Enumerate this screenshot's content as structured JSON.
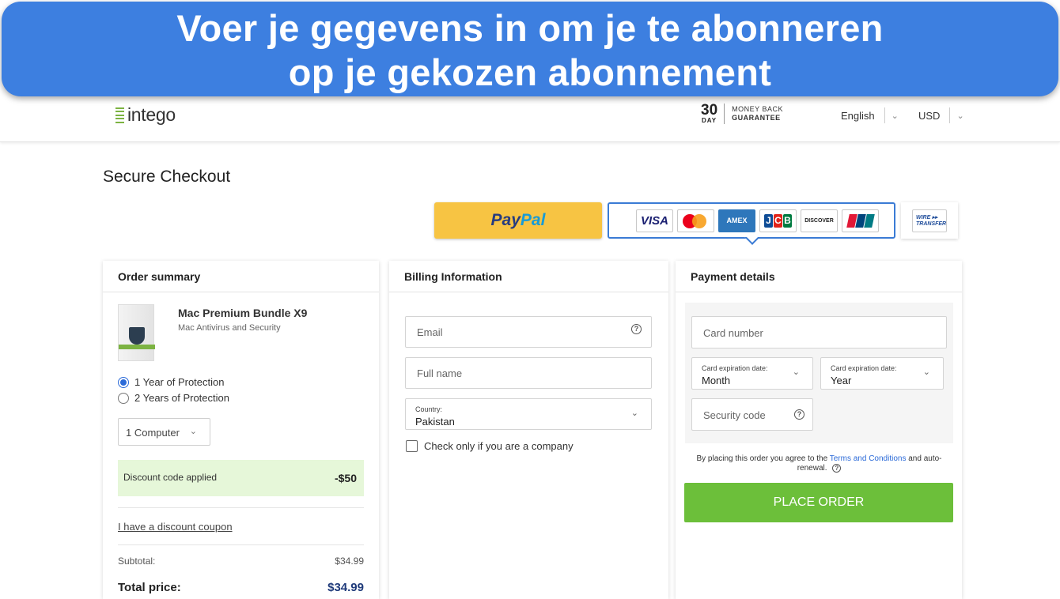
{
  "banner": {
    "line1": "Voer je gegevens in om je te abonneren",
    "line2": "op je gekozen abonnement"
  },
  "header": {
    "logo": "intego",
    "guarantee_days": "30",
    "guarantee_day_label": "DAY",
    "guarantee_line1": "MONEY BACK",
    "guarantee_line2": "GUARANTEE",
    "language": "English",
    "currency": "USD"
  },
  "page_title": "Secure Checkout",
  "payment_methods": {
    "paypal_pay": "Pay",
    "paypal_pal": "Pal",
    "cards": {
      "visa": "VISA",
      "amex": "AMEX",
      "jcb": [
        "J",
        "C",
        "B"
      ],
      "discover": "DISCOVER",
      "unionpay": "UnionPay"
    },
    "wire_line1": "WIRE ▸▸",
    "wire_line2": "TRANSFER"
  },
  "order_summary": {
    "title": "Order summary",
    "product_name": "Mac Premium Bundle X9",
    "product_sub": "Mac Antivirus and Security",
    "options": [
      {
        "label": "1 Year of Protection",
        "selected": true
      },
      {
        "label": "2 Years of Protection",
        "selected": false
      }
    ],
    "computers": "1 Computer",
    "discount_label": "Discount code applied",
    "discount_amount": "-$50",
    "coupon_link": "I have a discount coupon",
    "subtotal_label": "Subtotal:",
    "subtotal_value": "$34.99",
    "total_label": "Total price:",
    "total_value": "$34.99"
  },
  "billing": {
    "title": "Billing Information",
    "email_placeholder": "Email",
    "fullname_placeholder": "Full name",
    "country_label": "Country:",
    "country_value": "Pakistan",
    "company_checkbox": "Check only if you are a company"
  },
  "payment": {
    "title": "Payment details",
    "card_number_placeholder": "Card number",
    "exp_month_label": "Card expiration date:",
    "exp_month_value": "Month",
    "exp_year_label": "Card expiration date:",
    "exp_year_value": "Year",
    "security_code_placeholder": "Security code",
    "terms_prefix": "By placing this order you agree to the",
    "terms_link": "Terms and Conditions",
    "terms_suffix": "and auto-renewal.",
    "place_order": "PLACE ORDER"
  },
  "colors": {
    "banner": "#3d7fe0",
    "accent_blue": "#3a7bd5",
    "place_order_green": "#6cbf3a",
    "paypal_yellow": "#f7c443",
    "discount_bg": "#e6f7d9"
  }
}
